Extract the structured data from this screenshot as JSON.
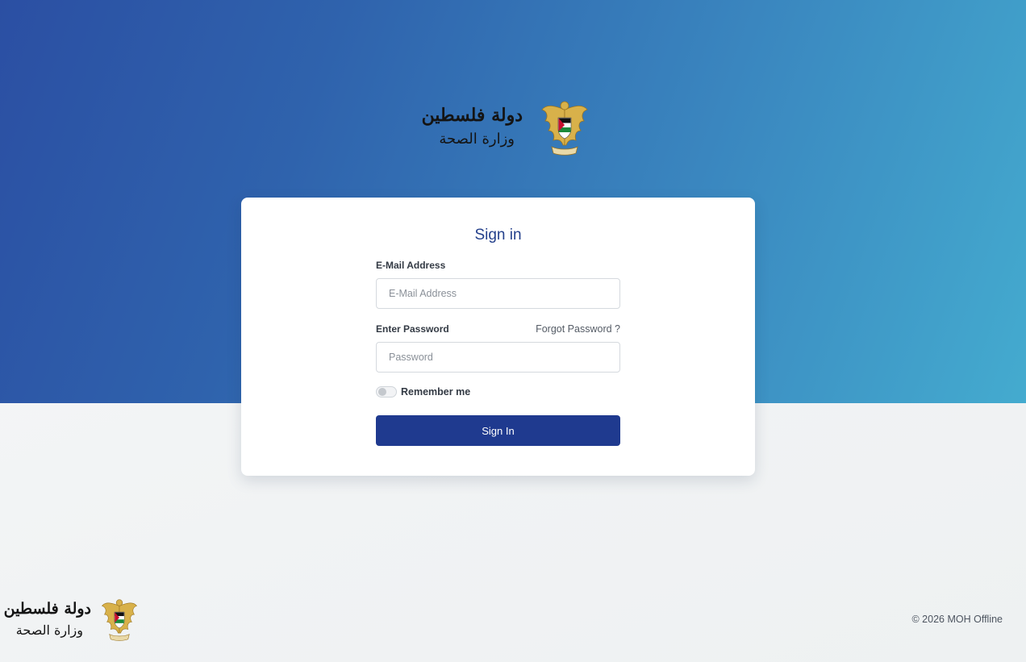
{
  "brand": {
    "country_ar": "دولة فلسطين",
    "ministry_ar": "وزارة الصحة"
  },
  "login": {
    "title": "Sign in",
    "email_label": "E-Mail Address",
    "email_placeholder": "E-Mail Address",
    "email_value": "",
    "password_label": "Enter Password",
    "password_placeholder": "Password",
    "password_value": "",
    "forgot_label": "Forgot Password ?",
    "remember_label": "Remember me",
    "remember_checked": false,
    "submit_label": "Sign In"
  },
  "footer": {
    "copyright": "© 2026 MOH Offline"
  },
  "colors": {
    "hero_start": "#2b4fa3",
    "hero_end": "#44abcf",
    "primary_button": "#1f3a8f",
    "title": "#25418c"
  },
  "icons": {
    "emblem": "palestine-eagle-emblem"
  }
}
